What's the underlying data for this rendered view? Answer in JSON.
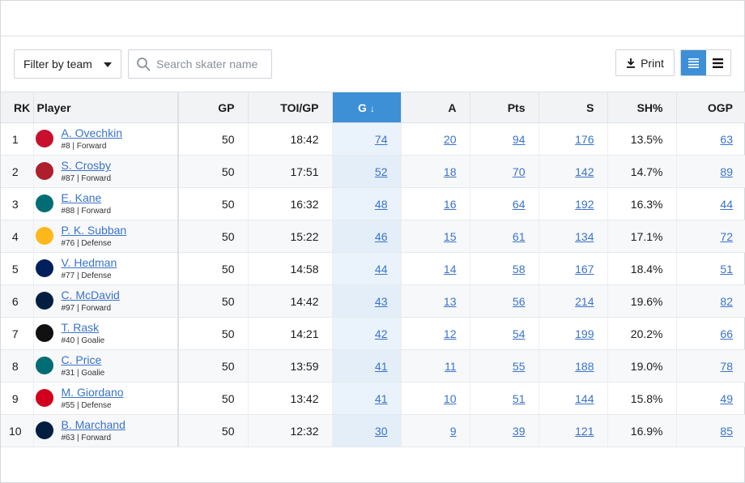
{
  "toolbar": {
    "filter_label": "Filter by team",
    "search_placeholder": "Search skater name",
    "print_label": "Print",
    "view_modes": [
      "list-view-icon",
      "compact-view-icon"
    ]
  },
  "colors": {
    "accent": "#3d8fd6",
    "link": "#3a73c8",
    "header_bg": "#f1f3f5",
    "sorted_col_bg": "#eaf3fb"
  },
  "table": {
    "columns": [
      "RK",
      "Player",
      "GP",
      "TOI/GP",
      "G",
      "A",
      "Pts",
      "S",
      "SH%",
      "OGP"
    ],
    "sorted_column": "G",
    "sort_icon": "arrow-down-icon",
    "rows": [
      {
        "rk": "1",
        "name": "A. Ovechkin",
        "meta": "#8 | Forward",
        "team_icon": "capitals-logo-icon",
        "team_color": "#c8102e",
        "gp": "50",
        "toi": "18:42",
        "g": "74",
        "a": "20",
        "pts": "94",
        "s": "176",
        "sh": "13.5%",
        "ogp": "63"
      },
      {
        "rk": "2",
        "name": "S. Crosby",
        "meta": "#87 | Forward",
        "team_icon": "canadiens-logo-icon",
        "team_color": "#af1e2d",
        "gp": "50",
        "toi": "17:51",
        "g": "52",
        "a": "18",
        "pts": "70",
        "s": "142",
        "sh": "14.7%",
        "ogp": "89"
      },
      {
        "rk": "3",
        "name": "E. Kane",
        "meta": "#88 | Forward",
        "team_icon": "sharks-logo-icon",
        "team_color": "#006d75",
        "gp": "50",
        "toi": "16:32",
        "g": "48",
        "a": "16",
        "pts": "64",
        "s": "192",
        "sh": "16.3%",
        "ogp": "44"
      },
      {
        "rk": "4",
        "name": "P. K. Subban",
        "meta": "#76 | Defense",
        "team_icon": "predators-logo-icon",
        "team_color": "#ffb81c",
        "gp": "50",
        "toi": "15:22",
        "g": "46",
        "a": "15",
        "pts": "61",
        "s": "134",
        "sh": "17.1%",
        "ogp": "72"
      },
      {
        "rk": "5",
        "name": "V. Hedman",
        "meta": "#77 | Defense",
        "team_icon": "canucks-logo-icon",
        "team_color": "#00205b",
        "gp": "50",
        "toi": "14:58",
        "g": "44",
        "a": "14",
        "pts": "58",
        "s": "167",
        "sh": "18.4%",
        "ogp": "51"
      },
      {
        "rk": "6",
        "name": "C. McDavid",
        "meta": "#97 | Forward",
        "team_icon": "oilers-logo-icon",
        "team_color": "#041e42",
        "gp": "50",
        "toi": "14:42",
        "g": "43",
        "a": "13",
        "pts": "56",
        "s": "214",
        "sh": "19.6%",
        "ogp": "82"
      },
      {
        "rk": "7",
        "name": "T. Rask",
        "meta": "#40 | Goalie",
        "team_icon": "bruins-logo-icon",
        "team_color": "#111111",
        "gp": "50",
        "toi": "14:21",
        "g": "42",
        "a": "12",
        "pts": "54",
        "s": "199",
        "sh": "20.2%",
        "ogp": "66"
      },
      {
        "rk": "8",
        "name": "C. Price",
        "meta": "#31 | Goalie",
        "team_icon": "sharks-logo-icon",
        "team_color": "#006d75",
        "gp": "50",
        "toi": "13:59",
        "g": "41",
        "a": "11",
        "pts": "55",
        "s": "188",
        "sh": "19.0%",
        "ogp": "78"
      },
      {
        "rk": "9",
        "name": "M. Giordano",
        "meta": "#55 | Defense",
        "team_icon": "flames-logo-icon",
        "team_color": "#d2001c",
        "gp": "50",
        "toi": "13:42",
        "g": "41",
        "a": "10",
        "pts": "51",
        "s": "144",
        "sh": "15.8%",
        "ogp": "49"
      },
      {
        "rk": "10",
        "name": "B. Marchand",
        "meta": "#63 | Forward",
        "team_icon": "panthers-logo-icon",
        "team_color": "#041e42",
        "gp": "50",
        "toi": "12:32",
        "g": "30",
        "a": "9",
        "pts": "39",
        "s": "121",
        "sh": "16.9%",
        "ogp": "85"
      }
    ]
  }
}
